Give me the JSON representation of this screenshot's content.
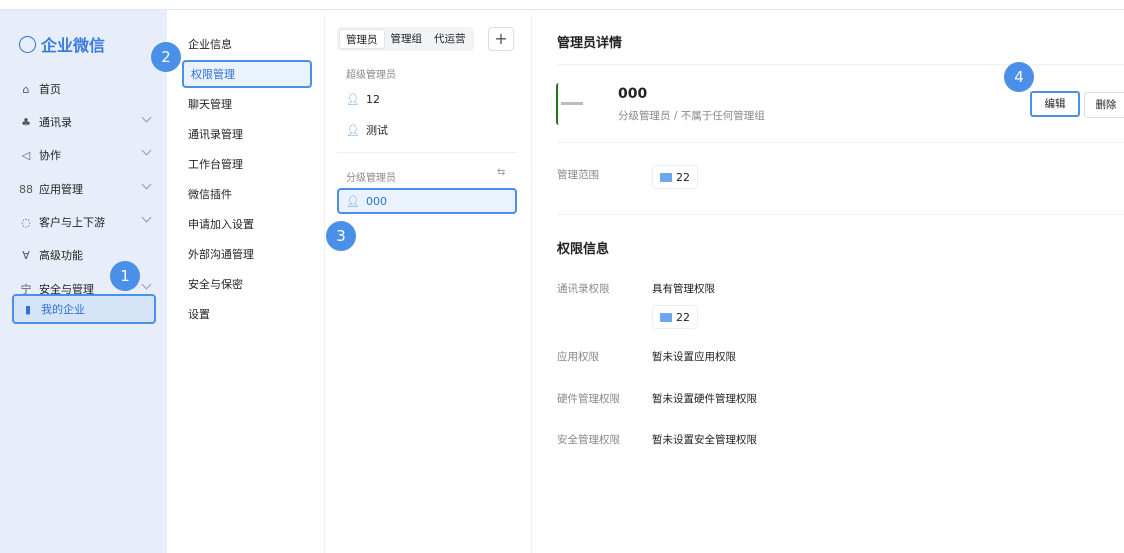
{
  "app": {
    "title": "企业微信"
  },
  "sidebar": {
    "items": [
      {
        "label": "首页",
        "icon": "home-icon",
        "glyph": "⌂",
        "chevron": false
      },
      {
        "label": "通讯录",
        "icon": "org-chart-icon",
        "glyph": "♣",
        "chevron": true
      },
      {
        "label": "协作",
        "icon": "collaboration-icon",
        "glyph": "◁",
        "chevron": true
      },
      {
        "label": "应用管理",
        "icon": "apps-grid-icon",
        "glyph": "88",
        "chevron": true
      },
      {
        "label": "客户与上下游",
        "icon": "chat-bubble-icon",
        "glyph": "◌",
        "chevron": true
      },
      {
        "label": "高级功能",
        "icon": "sparkle-icon",
        "glyph": "∀",
        "chevron": false
      },
      {
        "label": "安全与管理",
        "icon": "shield-icon",
        "glyph": "宁",
        "chevron": true
      },
      {
        "label": "我的企业",
        "icon": "company-icon",
        "glyph": "▮",
        "chevron": false,
        "active": true
      }
    ]
  },
  "submenu": {
    "items": [
      "企业信息",
      "权限管理",
      "聊天管理",
      "通讯录管理",
      "工作台管理",
      "微信插件",
      "申请加入设置",
      "外部沟通管理",
      "安全与保密",
      "设置"
    ],
    "active": "权限管理"
  },
  "admins": {
    "tabs": [
      "管理员",
      "管理组",
      "代运营"
    ],
    "active_tab": "管理员",
    "add": "+",
    "super_label": "超级管理员",
    "super": [
      "12",
      "测试"
    ],
    "sub_label": "分级管理员",
    "sub": [
      "000"
    ],
    "selected": "000"
  },
  "detail": {
    "title": "管理员详情",
    "name": "000",
    "subtitle": "分级管理员 / 不属于任何管理组",
    "edit": "编辑",
    "delete": "删除",
    "scope_label": "管理范围",
    "scope": "22",
    "perm_title": "权限信息",
    "perms": [
      {
        "label": "通讯录权限",
        "value": "具有管理权限",
        "chip": "22"
      },
      {
        "label": "应用权限",
        "value": "暂未设置应用权限"
      },
      {
        "label": "硬件管理权限",
        "value": "暂未设置硬件管理权限"
      },
      {
        "label": "安全管理权限",
        "value": "暂未设置安全管理权限"
      }
    ]
  },
  "badges": [
    "1",
    "2",
    "3",
    "4"
  ],
  "colors": {
    "accent": "#4a90e8",
    "sidebar_bg": "#e8eef9",
    "brand": "#3a7be0"
  }
}
